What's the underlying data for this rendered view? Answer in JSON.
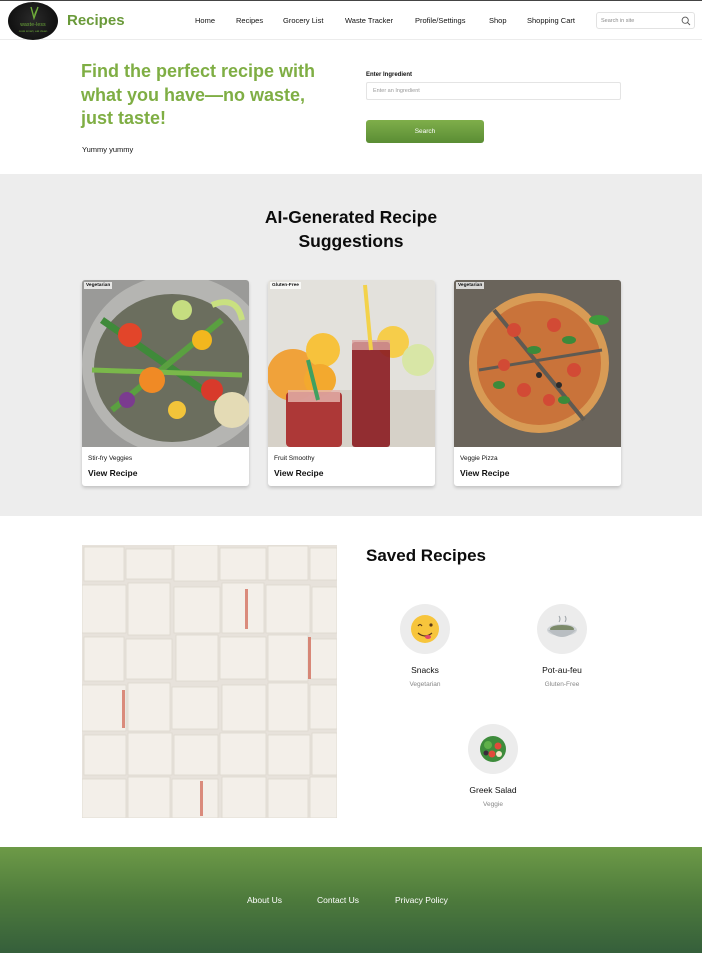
{
  "header": {
    "brand": "Recipes",
    "logo_text": "waste-less",
    "logo_subtext": "cook smart, eat clean",
    "nav": [
      "Home",
      "Recipes",
      "Grocery List",
      "Waste Tracker",
      "Profile/Settings",
      "Shop",
      "Shopping Cart"
    ],
    "search_placeholder": "Search in site"
  },
  "hero": {
    "title": "Find the perfect recipe with what you have—no waste, just taste!",
    "subtitle": "Yummy yummy",
    "ingredient_label": "Enter Ingredient",
    "ingredient_placeholder": "Enter an Ingredient",
    "search_label": "Search"
  },
  "ai": {
    "title_line1": "AI-Generated Recipe",
    "title_line2": "Suggestions",
    "cards": [
      {
        "tag": "Vegetarian",
        "name": "Stir-fry Veggies",
        "link": "View Recipe",
        "image": "stir-fry-image"
      },
      {
        "tag": "Gluten-Free",
        "name": "Fruit Smoothy",
        "link": "View Recipe",
        "image": "smoothie-image"
      },
      {
        "tag": "Vegetarian",
        "name": "Veggie Pizza",
        "link": "View Recipe",
        "image": "pizza-image"
      }
    ]
  },
  "saved": {
    "title": "Saved Recipes",
    "items": [
      {
        "name": "Snacks",
        "category": "Vegetarian",
        "icon": "smiley-face-icon"
      },
      {
        "name": "Pot-au-feu",
        "category": "Gluten-Free",
        "icon": "soup-bowl-icon"
      },
      {
        "name": "Greek Salad",
        "category": "Veggie",
        "icon": "salad-bowl-icon"
      }
    ]
  },
  "footer": {
    "links": [
      "About Us",
      "Contact Us",
      "Privacy Policy"
    ]
  },
  "colors": {
    "accent": "#7fae44",
    "button": "#6a9a3a",
    "section_bg": "#ededed",
    "footer_top": "#6d9a47",
    "footer_bottom": "#355f3b"
  }
}
